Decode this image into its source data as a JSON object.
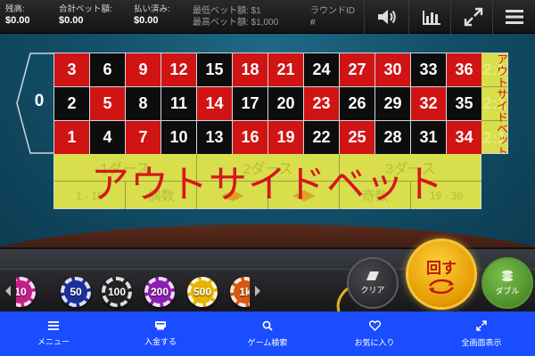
{
  "stats": {
    "balance_label": "残高:",
    "balance_value": "$0.00",
    "total_bet_label": "合計ベット額:",
    "total_bet_value": "$0.00",
    "paid_label": "払い済み:",
    "paid_value": "$0.00",
    "min_bet": "最低ベット額: $1",
    "max_bet": "最高ベット額: $1,000",
    "round_label": "ラウンドID",
    "round_value": "#"
  },
  "toolbar_icons": [
    "volume-icon",
    "stats-icon",
    "fullscreen-icon",
    "menu-icon"
  ],
  "table": {
    "zero": "0",
    "rows": [
      [
        "3",
        "6",
        "9",
        "12",
        "15",
        "18",
        "21",
        "24",
        "27",
        "30",
        "33",
        "36"
      ],
      [
        "2",
        "5",
        "8",
        "11",
        "14",
        "17",
        "20",
        "23",
        "26",
        "29",
        "32",
        "35"
      ],
      [
        "1",
        "4",
        "7",
        "10",
        "13",
        "16",
        "19",
        "22",
        "25",
        "28",
        "31",
        "34"
      ]
    ],
    "colors": [
      [
        "red",
        "black",
        "red",
        "red",
        "black",
        "red",
        "red",
        "black",
        "red",
        "red",
        "black",
        "red"
      ],
      [
        "black",
        "red",
        "black",
        "black",
        "red",
        "black",
        "black",
        "red",
        "black",
        "black",
        "red",
        "black"
      ],
      [
        "red",
        "black",
        "red",
        "black",
        "black",
        "red",
        "red",
        "black",
        "red",
        "black",
        "black",
        "red"
      ]
    ],
    "column_bets": [
      "2:1",
      "2:1",
      "2:1"
    ],
    "column_overlay": "アウトサイドベット",
    "dozens": [
      "1ダース",
      "2ダース",
      "3ダース"
    ],
    "even_bets": [
      "1 - 18",
      "偶数",
      "",
      "",
      "奇数",
      "19 - 36"
    ],
    "outside_overlay": "アウトサイドベット",
    "red_color": "#d01414",
    "black_color": "#0d0d0d",
    "outside_color": "#d8de4c"
  },
  "chips": [
    {
      "label": "10",
      "color": "#c0208a"
    },
    {
      "label": "50",
      "color": "#1a2f9a"
    },
    {
      "label": "100",
      "color": "#222222"
    },
    {
      "label": "200",
      "color": "#8d1fb0"
    },
    {
      "label": "500",
      "color": "#e6b400"
    },
    {
      "label": "1k",
      "color": "#d55a10"
    }
  ],
  "buttons": {
    "clear": "クリア",
    "spin": "回す",
    "double": "ダブル"
  },
  "nav": [
    {
      "label": "メニュー",
      "icon": "hamburger-icon"
    },
    {
      "label": "入金する",
      "icon": "deposit-icon"
    },
    {
      "label": "ゲーム検索",
      "icon": "search-icon"
    },
    {
      "label": "お気に入り",
      "icon": "heart-icon"
    },
    {
      "label": "全画面表示",
      "icon": "fullscreen-icon"
    }
  ]
}
